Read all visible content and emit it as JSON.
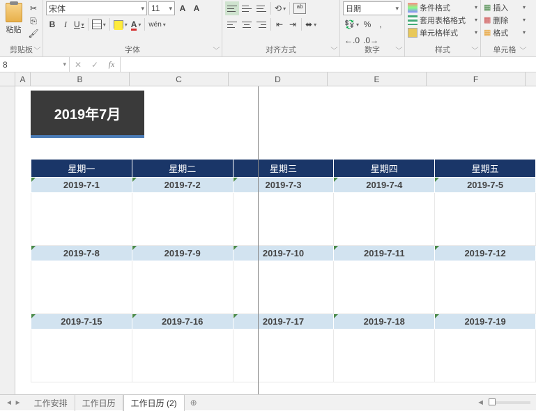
{
  "ribbon": {
    "clipboard": {
      "label": "剪贴板",
      "paste": "粘贴"
    },
    "font": {
      "label": "字体",
      "name": "宋体",
      "size": "11",
      "bold": "B",
      "italic": "I",
      "underline": "U",
      "fontColor": "A",
      "increase": "A",
      "decrease": "A",
      "wen": "wén"
    },
    "align": {
      "label": "对齐方式"
    },
    "number": {
      "label": "数字",
      "format": "日期",
      "percent": "%",
      "comma": ",",
      "dec_inc": ".0",
      "dec_dec": ".0"
    },
    "styles": {
      "label": "样式",
      "cond": "条件格式",
      "table": "套用表格格式",
      "cell": "单元格样式"
    },
    "cells": {
      "label": "单元格",
      "insert": "插入",
      "delete": "删除",
      "format": "格式"
    }
  },
  "formula_bar": {
    "name_box": "8",
    "fx": "fx"
  },
  "columns": [
    "A",
    "B",
    "C",
    "D",
    "E",
    "F"
  ],
  "sheet": {
    "title": "2019年7月",
    "headers": [
      "星期一",
      "星期二",
      "星期三",
      "星期四",
      "星期五"
    ],
    "rows": [
      [
        "2019-7-1",
        "2019-7-2",
        "2019-7-3",
        "2019-7-4",
        "2019-7-5"
      ],
      [
        "2019-7-8",
        "2019-7-9",
        "2019-7-10",
        "2019-7-11",
        "2019-7-12"
      ],
      [
        "2019-7-15",
        "2019-7-16",
        "2019-7-17",
        "2019-7-18",
        "2019-7-19"
      ]
    ]
  },
  "tabs": {
    "t1": "工作安排",
    "t2": "工作日历",
    "t3": "工作日历 (2)",
    "add": "⊕"
  }
}
